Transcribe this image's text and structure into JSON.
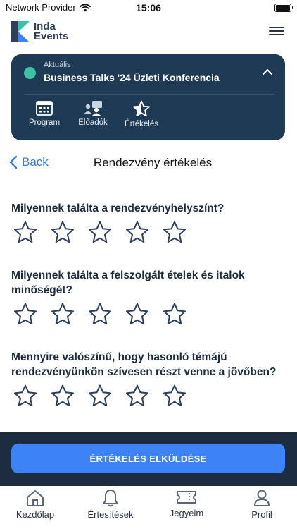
{
  "status_bar": {
    "carrier": "Network Provider",
    "time": "15:06"
  },
  "app": {
    "logo_line1": "Inda",
    "logo_line2": "Events"
  },
  "event": {
    "subtitle": "Aktuális",
    "title": "Business Talks '24 Üzleti Konferencia",
    "nav": [
      {
        "label": "Program",
        "icon": "calendar-icon"
      },
      {
        "label": "Előadók",
        "icon": "speakers-icon"
      },
      {
        "label": "Értékelés",
        "icon": "star-rating-icon"
      }
    ],
    "colors": {
      "card": "#1f3a55",
      "status_dot": "#3cc3a6"
    }
  },
  "page": {
    "back_label": "Back",
    "title": "Rendezvény értékelés"
  },
  "questions": [
    {
      "text": "Milyennek találta a rendezvényhelyszínt?",
      "rating": 0,
      "max": 5
    },
    {
      "text": "Milyennek találta a felszolgált ételek és italok minőségét?",
      "rating": 0,
      "max": 5
    },
    {
      "text": "Mennyire valószínű, hogy hasonló témájú rendezvényünkön szívesen részt venne a jövőben?",
      "rating": 0,
      "max": 5
    }
  ],
  "submit": {
    "label": "ÉRTÉKELÉS ELKÜLDÉSE",
    "color": "#3e82f7"
  },
  "tabs": [
    {
      "label": "Kezdőlap",
      "icon": "home-icon"
    },
    {
      "label": "Értesítések",
      "icon": "bell-icon"
    },
    {
      "label": "Jegyeim",
      "icon": "ticket-icon"
    },
    {
      "label": "Profil",
      "icon": "profile-icon"
    }
  ]
}
